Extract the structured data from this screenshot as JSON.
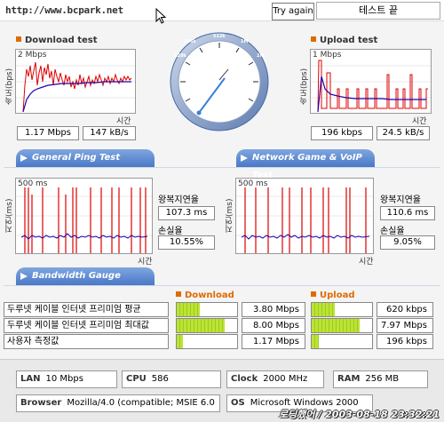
{
  "header": {
    "url": "http://www.bcpark.net",
    "try_again": "Try again",
    "test_end": "테스트 끝"
  },
  "download": {
    "title": "Download test",
    "ylabel": "속도(bps)",
    "scale": "2 Mbps",
    "xlabel": "시간",
    "speed_bits": "1.17 Mbps",
    "speed_bytes": "147 kB/s"
  },
  "upload": {
    "title": "Upload test",
    "ylabel": "속도(bps)",
    "scale": "1 Mbps",
    "xlabel": "시간",
    "speed_bits": "196 kbps",
    "speed_bytes": "24.5 kB/s"
  },
  "ping": {
    "tab": "General Ping Test",
    "ylabel": "지연(ms)",
    "scale": "500 ms",
    "xlabel": "시간",
    "rtt_label": "왕복지연율",
    "rtt_value": "107.3 ms",
    "loss_label": "손실율",
    "loss_value": "10.55%"
  },
  "game": {
    "tab": "Network Game & VoIP Test",
    "ylabel": "지연(ms)",
    "scale": "500 ms",
    "xlabel": "시간",
    "rtt_label": "왕복지연율",
    "rtt_value": "110.6 ms",
    "loss_label": "손실율",
    "loss_value": "9.05%"
  },
  "gauge": {
    "tab": "Bandwidth Gauge",
    "download_label": "Download",
    "upload_label": "Upload",
    "rows": [
      {
        "label": "두루넷 케이블 인터넷 프리미엄 평균",
        "down": "3.80 Mbps",
        "down_level": 0.38,
        "up": "620 kbps",
        "up_level": 0.38
      },
      {
        "label": "두루넷 케이블 인터넷 프리미엄 최대값",
        "down": "8.00 Mbps",
        "down_level": 0.8,
        "up": "7.97 Mbps",
        "up_level": 0.8
      },
      {
        "label": "사용자 측정값",
        "down": "1.17 Mbps",
        "down_level": 0.1,
        "up": "196 kbps",
        "up_level": 0.12
      }
    ]
  },
  "sysinfo": {
    "lan_label": "LAN",
    "lan": "10 Mbps",
    "cpu_label": "CPU",
    "cpu": "586",
    "clock_label": "Clock",
    "clock": "2000 MHz",
    "ram_label": "RAM",
    "ram": "256 MB",
    "browser_label": "Browser",
    "browser": "Mozilla/4.0 (compatible; MSIE 6.0",
    "os_label": "OS",
    "os": "Microsoft Windows 2000"
  },
  "footer": {
    "stamp": "로딩했어 / 2003-08-18 23:32:21"
  },
  "colors": {
    "accent": "#e06a00",
    "tab": "#4a78c7",
    "line_red": "#dd0000",
    "line_blue": "#2200aa",
    "meter": "#a6d428"
  }
}
